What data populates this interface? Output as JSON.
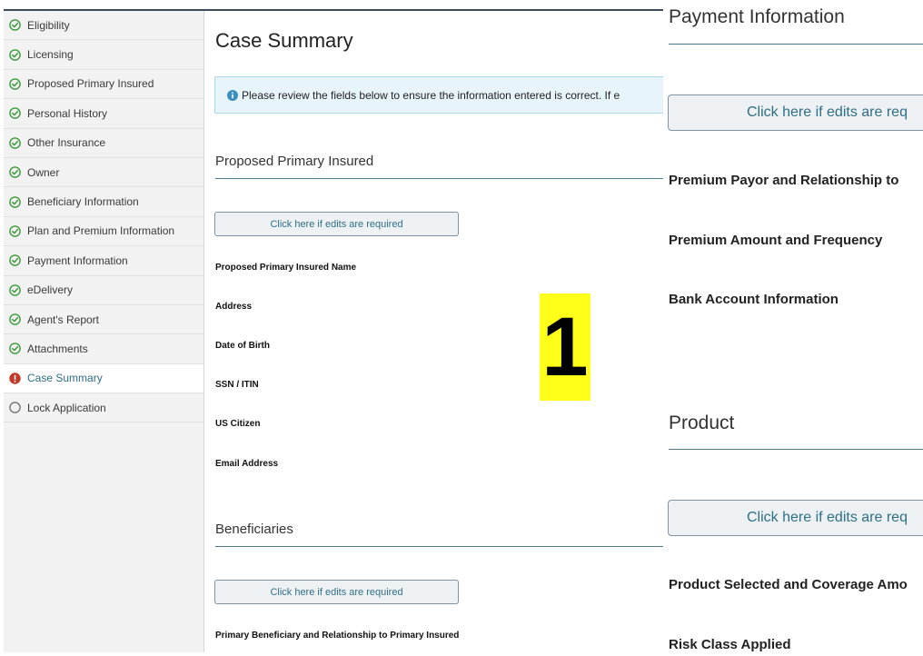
{
  "sidebar": {
    "items": [
      {
        "label": "Eligibility",
        "status": "complete"
      },
      {
        "label": "Licensing",
        "status": "complete"
      },
      {
        "label": "Proposed Primary Insured",
        "status": "complete"
      },
      {
        "label": "Personal History",
        "status": "complete"
      },
      {
        "label": "Other Insurance",
        "status": "complete"
      },
      {
        "label": "Owner",
        "status": "complete"
      },
      {
        "label": "Beneficiary Information",
        "status": "complete"
      },
      {
        "label": "Plan and Premium Information",
        "status": "complete"
      },
      {
        "label": "Payment Information",
        "status": "complete"
      },
      {
        "label": "eDelivery",
        "status": "complete"
      },
      {
        "label": "Agent's Report",
        "status": "complete"
      },
      {
        "label": "Attachments",
        "status": "complete"
      },
      {
        "label": "Case Summary",
        "status": "error"
      },
      {
        "label": "Lock Application",
        "status": "pending"
      }
    ]
  },
  "main": {
    "title": "Case Summary",
    "banner_text": "Please review the fields below to ensure the information entered is correct.  If e",
    "edit_label": "Click here if edits are required",
    "sections": {
      "insured": {
        "title": "Proposed Primary Insured",
        "fields": [
          "Proposed Primary Insured Name",
          "Address",
          "Date of Birth",
          "SSN / ITIN",
          "US Citizen",
          "Email Address"
        ]
      },
      "beneficiaries": {
        "title": "Beneficiaries",
        "fields": [
          "Primary Beneficiary and Relationship to Primary Insured"
        ]
      }
    }
  },
  "badge": "1",
  "right_panel": {
    "edit_label": "Click here if edits are req",
    "payment": {
      "title": "Payment Information",
      "fields": [
        "Premium Payor and Relationship to",
        "Premium Amount and Frequency",
        "Bank Account Information"
      ]
    },
    "product": {
      "title": "Product",
      "fields": [
        "Product Selected and Coverage Amo",
        "Risk Class Applied"
      ]
    }
  },
  "colors": {
    "complete": "#3c9a3c",
    "error": "#c0392b",
    "pending": "#666666",
    "accent": "#2f6f85",
    "banner_bg": "#e7f4fa",
    "badge": "#ffff1a"
  }
}
